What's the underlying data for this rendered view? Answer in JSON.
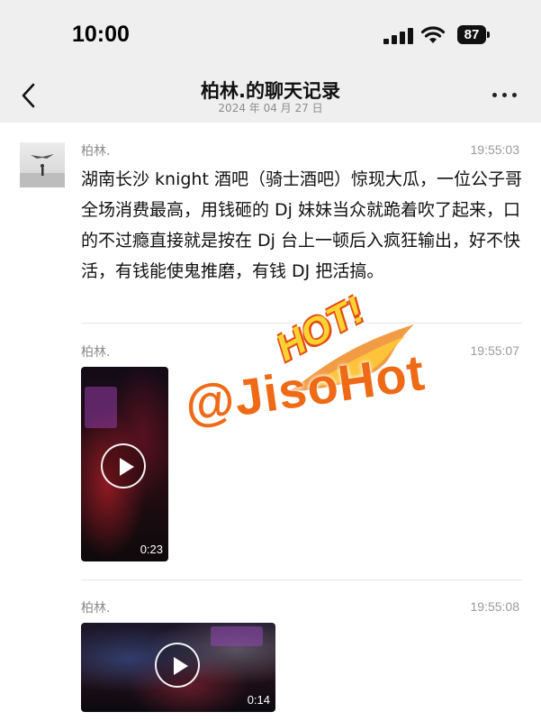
{
  "status_bar": {
    "time": "10:00",
    "battery": "87"
  },
  "header": {
    "title": "柏林.的聊天记录",
    "date": "2024 年 04 月 27 日"
  },
  "messages": [
    {
      "sender": "柏林.",
      "time": "19:55:03",
      "text": "湖南长沙 knight 酒吧（骑士酒吧）惊现大瓜，一位公子哥全场消费最高，用钱砸的 Dj 妹妹当众就跪着吹了起来，口的不过瘾直接就是按在 Dj 台上一顿后入疯狂输出，好不快活，有钱能使鬼推磨，有钱 DJ 把活搞。"
    },
    {
      "sender": "柏林.",
      "time": "19:55:07",
      "video_duration": "0:23"
    },
    {
      "sender": "柏林.",
      "time": "19:55:08",
      "video_duration": "0:14"
    }
  ],
  "watermark": {
    "badge": "HOT!",
    "handle": "@JisoHot"
  },
  "colors": {
    "header_bg": "#efefef",
    "watermark_orange": "#ef6a16",
    "watermark_yellow": "#ffd234"
  }
}
